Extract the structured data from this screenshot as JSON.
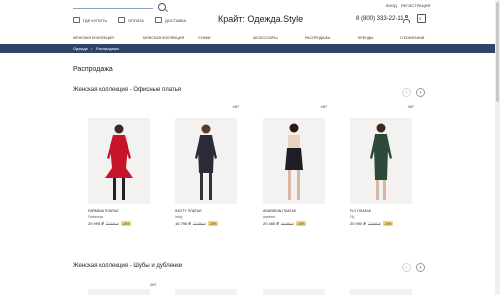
{
  "header": {
    "links": [
      {
        "label": "ГДЕ КУПИТЬ",
        "icon": "shop-icon"
      },
      {
        "label": "ОПЛАТА",
        "icon": "wallet-icon"
      },
      {
        "label": "ДОСТАВКА",
        "icon": "truck-icon"
      }
    ],
    "brand": "Крайт: Одежда.Style",
    "phone": "8 (800) 333-22-11",
    "login": "ВХОД",
    "register": "РЕГИСТРАЦИЯ",
    "cart_count": "0"
  },
  "nav": [
    "ЖЕНСКАЯ КОЛЛЕКЦИЯ",
    "МУЖСКАЯ КОЛЛЕКЦИЯ",
    "СУМКИ",
    "АКСЕССУАРЫ",
    "РАСПРОДАЖА",
    "БРЕНДЫ",
    "О КОМПАНИИ"
  ],
  "breadcrumb": [
    "Одежда",
    "Распродажа"
  ],
  "page_title": "Распродажа",
  "sections": [
    {
      "title": "Женская коллекция - Офисные платья",
      "products": [
        {
          "name": "FARMINA ПЛАТЬЕ",
          "sub": "Farminova",
          "price": "20 995 ₽",
          "old": "32 995 ₽",
          "discount": "-40%",
          "hit": "",
          "color": "#c8142b"
        },
        {
          "name": "INCITY ПЛАТЬЕ",
          "sub": "Incity",
          "price": "16 795 ₽",
          "old": "22 995 ₽",
          "discount": "-30%",
          "hit": "ХИТ",
          "color": "#2a2a38"
        },
        {
          "name": "ANAREKIN ПЛАТЬЕ",
          "sub": "anadrea",
          "price": "20 480 ₽",
          "old": "34 995 ₽",
          "discount": "-40%",
          "hit": "ХИТ",
          "color": "#1e1e24"
        },
        {
          "name": "FLY ПЛАТЬЕ",
          "sub": "Fly",
          "price": "20 990 ₽",
          "old": "22 995 ₽",
          "discount": "-30%",
          "hit": "ХИТ",
          "color": "#2e4a3a"
        }
      ]
    },
    {
      "title": "Женская коллекция - Шубы и дубленки",
      "hit": "ХИТ"
    }
  ],
  "arrows": {
    "prev": "‹",
    "next": "›"
  }
}
